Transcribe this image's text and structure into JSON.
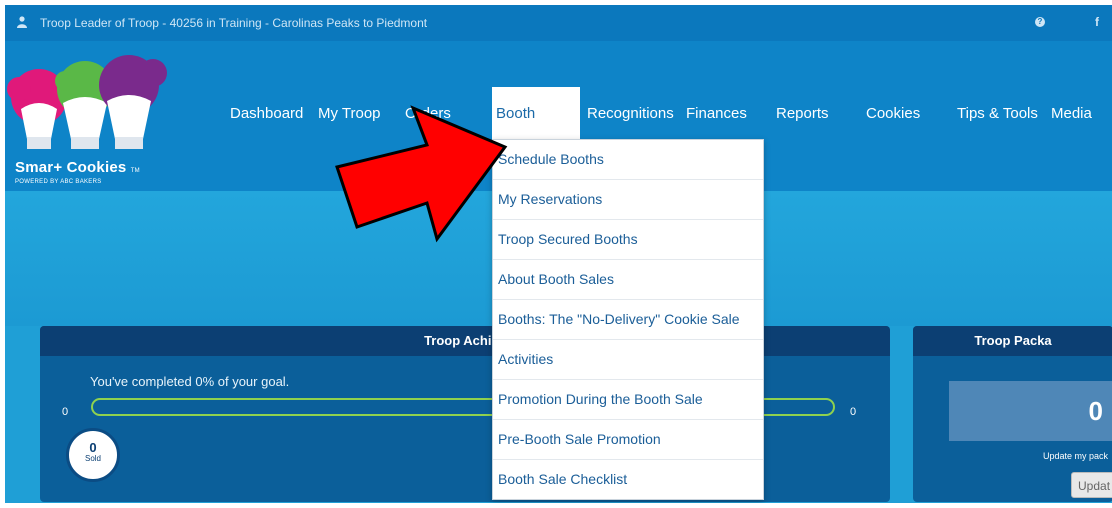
{
  "topbar": {
    "role_text": "Troop Leader of Troop - 40256 in Training - Carolinas Peaks to Piedmont",
    "icons": [
      "user-icon",
      "help-icon",
      "facebook-icon"
    ],
    "fb_glyph": "f"
  },
  "logo": {
    "title": "Smar+ Cookies",
    "tm": "TM",
    "subtitle": "POWERED BY ABC BAKERS",
    "colors": [
      "#e0197a",
      "#5ab847",
      "#7a2a8c"
    ]
  },
  "nav": {
    "items": [
      "Dashboard",
      "My Troop",
      "Orders",
      "Booth",
      "Recognitions",
      "Finances",
      "Reports",
      "Cookies",
      "Tips & Tools",
      "Media"
    ],
    "active": "Booth"
  },
  "booth_menu": {
    "items": [
      "Schedule Booths",
      "My Reservations",
      "Troop Secured Booths",
      "About Booth Sales",
      "Booths: The \"No-Delivery\" Cookie Sale",
      "Activities",
      "Promotion During the Booth Sale",
      "Pre-Booth Sale Promotion",
      "Booth Sale Checklist"
    ]
  },
  "annotation": {
    "type": "red-arrow",
    "color": "#ff0000",
    "points_to": "Schedule Booths"
  },
  "achievement": {
    "title": "Troop Achiev",
    "goal_text": "You've completed 0% of your goal.",
    "min": "0",
    "max": "0",
    "progress": 0,
    "sold_value": "0",
    "sold_label": "Sold"
  },
  "packages": {
    "title": "Troop Packa",
    "value": "0",
    "update_text": "Update my pack",
    "button_label": "Updat"
  },
  "colors": {
    "topbar": "#0b78bd",
    "header": "#0e84c8",
    "hero": "#1f9fd6",
    "panel": "#0b5f9a",
    "panel_header": "#0c3f73",
    "progress": "#8fd14f",
    "menu_text": "#1b5e98"
  }
}
